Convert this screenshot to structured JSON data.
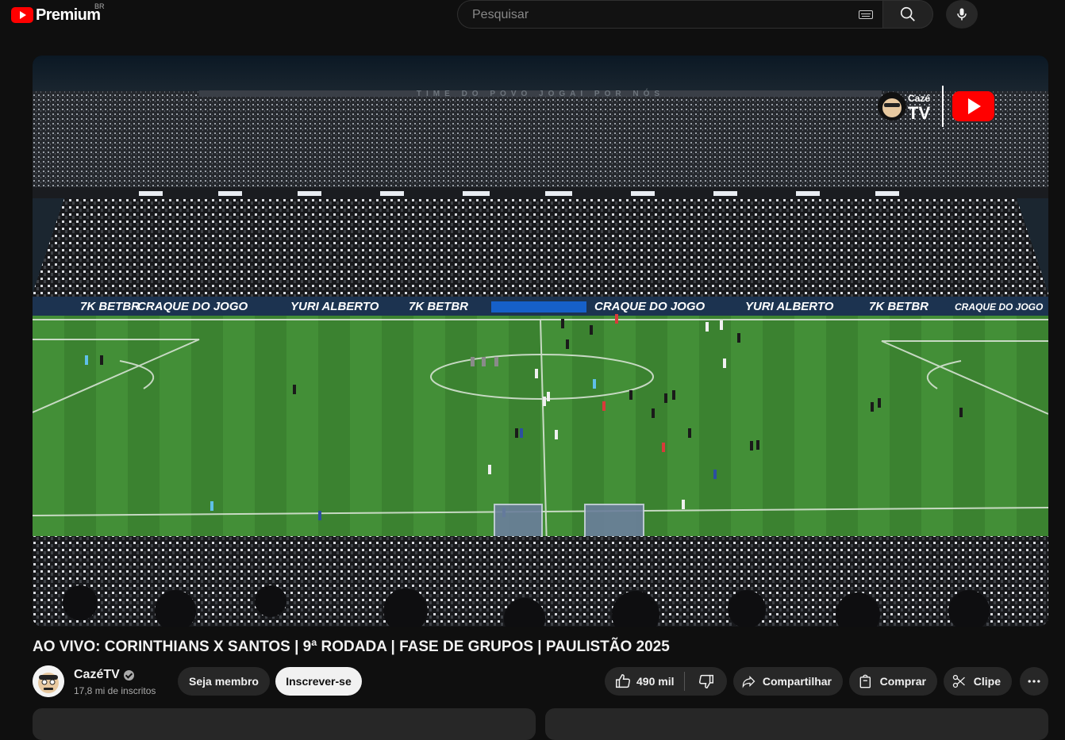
{
  "header": {
    "logo_text": "Premium",
    "logo_country": "BR",
    "search_placeholder": "Pesquisar",
    "icons": [
      "youtube-logo-icon",
      "keyboard-icon",
      "search-icon",
      "mic-icon"
    ]
  },
  "player": {
    "stadium_banners": [
      "CRAQUE DO JOGO",
      "YURI ALBERTO",
      "7K BETBR",
      "CRAQUE DO JOGO",
      "YURI ALBERTO",
      "7K BETBR",
      "CRAQUE DO JOGO"
    ],
    "tier_text": "TIME DO POVO     JOGAI POR NÓS",
    "overlay_logo_line1": "Cazé",
    "overlay_logo_line2": "TV"
  },
  "video": {
    "title": "AO VIVO: CORINTHIANS X SANTOS | 9ª RODADA | FASE DE GRUPOS | PAULISTÃO 2025"
  },
  "owner": {
    "channel_name": "CazéTV",
    "subscribers": "17,8 mi de inscritos",
    "member_label": "Seja membro",
    "subscribe_label": "Inscrever-se"
  },
  "actions": {
    "like_count": "490 mil",
    "share_label": "Compartilhar",
    "buy_label": "Comprar",
    "clip_label": "Clipe"
  },
  "colors": {
    "background": "#0f0f0f",
    "brand_red": "#ff0000",
    "button_bg": "#272727",
    "pitch_green": "#3f8a34"
  }
}
